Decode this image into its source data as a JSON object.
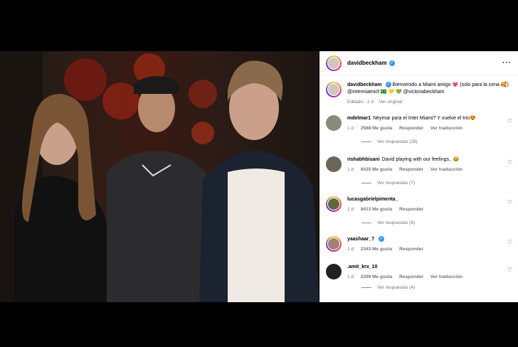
{
  "post": {
    "username": "davidbeckham",
    "more_icon": "more-dots-icon",
    "caption": {
      "username": "davidbeckham",
      "text_1": "Bienvenido a Miami amigo 💗 (solo para la cena 🥰) ",
      "mention_1": "@intermiamicf",
      "text_2": " 🇧🇷 💛 💚 ",
      "mention_2": "@victoriabeckham",
      "edited": "Editado · 1 d",
      "see_original": "Ver original"
    }
  },
  "comments": [
    {
      "username": "mdelmar1",
      "text": "Neymar para el Inter Miami? Y vuelve el trio😍",
      "time": "1 d",
      "likes": "2588 Me gusta",
      "reply": "Responder",
      "translate": "Ver traducción",
      "replies": "Ver respuestas (26)",
      "verified": false
    },
    {
      "username": "rishabhbisani",
      "text": "David playing with our feelings.. 😂",
      "time": "1 d",
      "likes": "8425 Me gusta",
      "reply": "Responder",
      "translate": "Ver traducción",
      "replies": "Ver respuestas (7)",
      "verified": false
    },
    {
      "username": "lucasgabrielpimenta_",
      "text": "",
      "time": "1 d",
      "likes": "8413 Me gusta",
      "reply": "Responder",
      "translate": "",
      "replies": "Ver respuestas (6)",
      "verified": false
    },
    {
      "username": "yaashaar_7",
      "text": "",
      "time": "1 d",
      "likes": "2343 Me gusta",
      "reply": "Responder",
      "translate": "",
      "replies": "",
      "verified": true
    },
    {
      "username": ".amit_krx_10",
      "text": "",
      "time": "1 d",
      "likes": "2299 Me gusta",
      "reply": "Responder",
      "translate": "Ver traducción",
      "replies": "Ver respuestas (4)",
      "verified": false
    }
  ],
  "colors": {
    "accent": "#3897f0",
    "muted": "#737373",
    "background": "#000000"
  }
}
